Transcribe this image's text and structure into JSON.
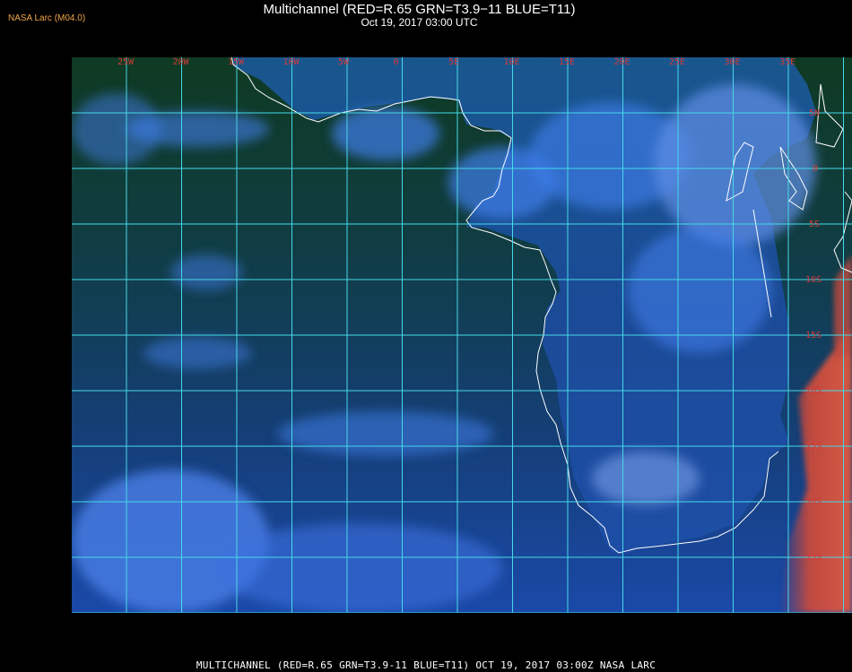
{
  "header": {
    "title": "Multichannel (RED=R.65 GRN=T3.9−11 BLUE=T11)",
    "subtitle": "Oct 19, 2017 03:00 UTC",
    "producer": "NASA Larc (M04.0)"
  },
  "footer": {
    "text": "MULTICHANNEL (RED=R.65 GRN=T3.9-11 BLUE=T11) OCT 19, 2017 03:00Z   NASA LARC"
  },
  "map": {
    "lon_labels": [
      "25W",
      "20W",
      "15W",
      "10W",
      "5W",
      "0",
      "5E",
      "10E",
      "15E",
      "20E",
      "25E",
      "30E",
      "35E"
    ],
    "lat_labels": [
      "5N",
      "0",
      "5S",
      "10S",
      "15S",
      "20S",
      "25S",
      "30S",
      "35S",
      "40S"
    ],
    "colors": {
      "grid": "#46d9e8",
      "coastline": "#ffffff",
      "label": "#d23a3a",
      "ocean_dark": "#0f3a2c",
      "ocean_blue": "#1a49a8",
      "cloud": "#3f7de8",
      "hot_land": "#d44a3a"
    }
  }
}
